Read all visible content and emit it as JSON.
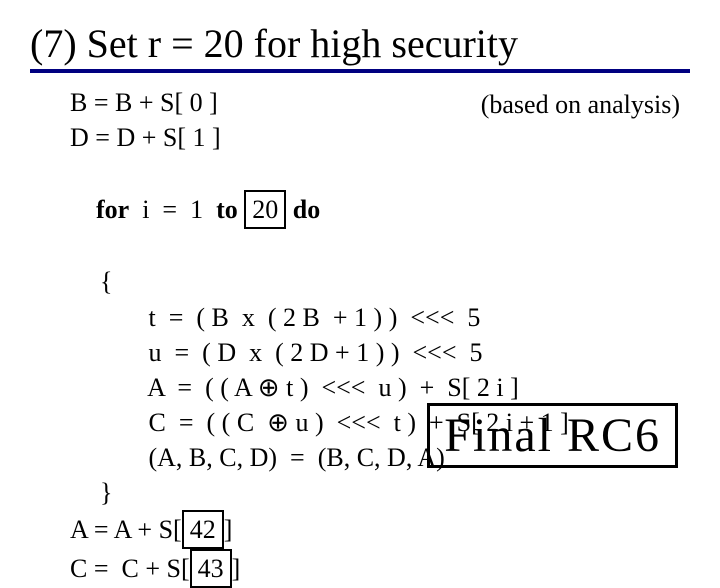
{
  "title": "(7) Set r = 20 for high security",
  "note": "(based on analysis)",
  "code": {
    "l1a": "B = B + S[ 0 ]",
    "l2": "D = D + S[ 1 ]",
    "l3a": "for",
    "l3b": "  i  =  1  ",
    "l3c": "to",
    "l3box": "20",
    "l3d": "do",
    "l4": "{",
    "l5": " t  =  ( B  x  ( 2 B  + 1 ) )  <<<  5",
    "l6": " u  =  ( D  x  ( 2 D + 1 ) )  <<<  5",
    "l7a": " A  =  ( ( A ",
    "oplus": "⊕",
    "l7b": " t )  <<<  u )  +  S[ 2 i ]",
    "l8a": " C  =  ( ( C  ",
    "l8b": " u )  <<<  t )  +  S[ 2 i + 1 ]",
    "l9": " (A, B, C, D)  =  (B, C, D, A)",
    "l10": "}",
    "l11a": "A = A + S[",
    "l11box": "42",
    "l11b": "]",
    "l12a": "C =  C + S[",
    "l12box": "43",
    "l12b": "]"
  },
  "final": "Final RC6"
}
